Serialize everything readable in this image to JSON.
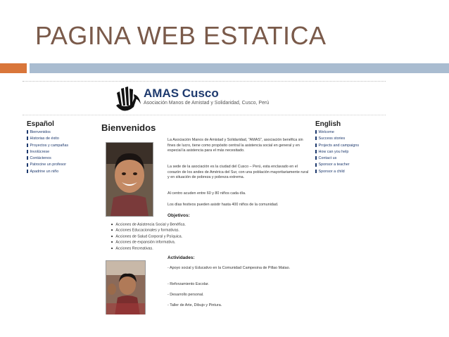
{
  "slide": {
    "title": "PAGINA WEB ESTATICA",
    "accent_orange": "#d9763a",
    "accent_blue": "#a9bcd0"
  },
  "site": {
    "logo_title": "AMAS Cusco",
    "logo_subtitle": "Asociación Manos de Amistad y Solidaridad, Cusco, Perú",
    "left_nav": {
      "heading": "Español",
      "items": [
        "Bienvenidos",
        "Historias de éxito",
        "Proyectos y campañas",
        "Involúcrese",
        "Contáctenos",
        "Patrocine un profesor",
        "Apadrine un niño"
      ]
    },
    "right_nav": {
      "heading": "English",
      "items": [
        "Welcome",
        "Success stories",
        "Projects and campaigns",
        "How can you help",
        "Contact us",
        "Sponsor a teacher",
        "Sponsor a child"
      ]
    },
    "main": {
      "heading": "Bienvenidos",
      "p1": "La Asociación Manos de Amistad y Solidaridad, \"AMAS\", asociación benéfica sin fines de lucro, tiene como propósito central la asistencia social en general y en especial la asistencia para el más necesitado.",
      "p2": "La sede de la asociación es la ciudad del Cusco – Perú, esta enclavado en el corazón de los andes de América del Sur, con una población mayoritariamente rural y en situación de pobreza y pobreza extrema.",
      "p3": "Al centro acuden entre 60 y 80 niños cada día.",
      "p4": "Los días festivos pueden asistir hasta 400 niños de la comunidad.",
      "objectives_heading": "Objetivos:",
      "objectives": [
        "Acciones de Asistencia Social y Benéfica.",
        "Acciones Educacionales y formativas.",
        "Acciones de Salud Corporal y Psíquica.",
        "Acciones de expansión informativa.",
        "Acciones Recreativas."
      ],
      "activities_heading": "Actividades:",
      "a1": "- Apoyo social y Educativo en la Comunidad Campesina de Pillao Matao.",
      "a2": "- Reforzamiento Escolar.",
      "a3": "- Desarrollo personal.",
      "a4": "- Taller de Arte, Dibujo y Pintura."
    }
  }
}
